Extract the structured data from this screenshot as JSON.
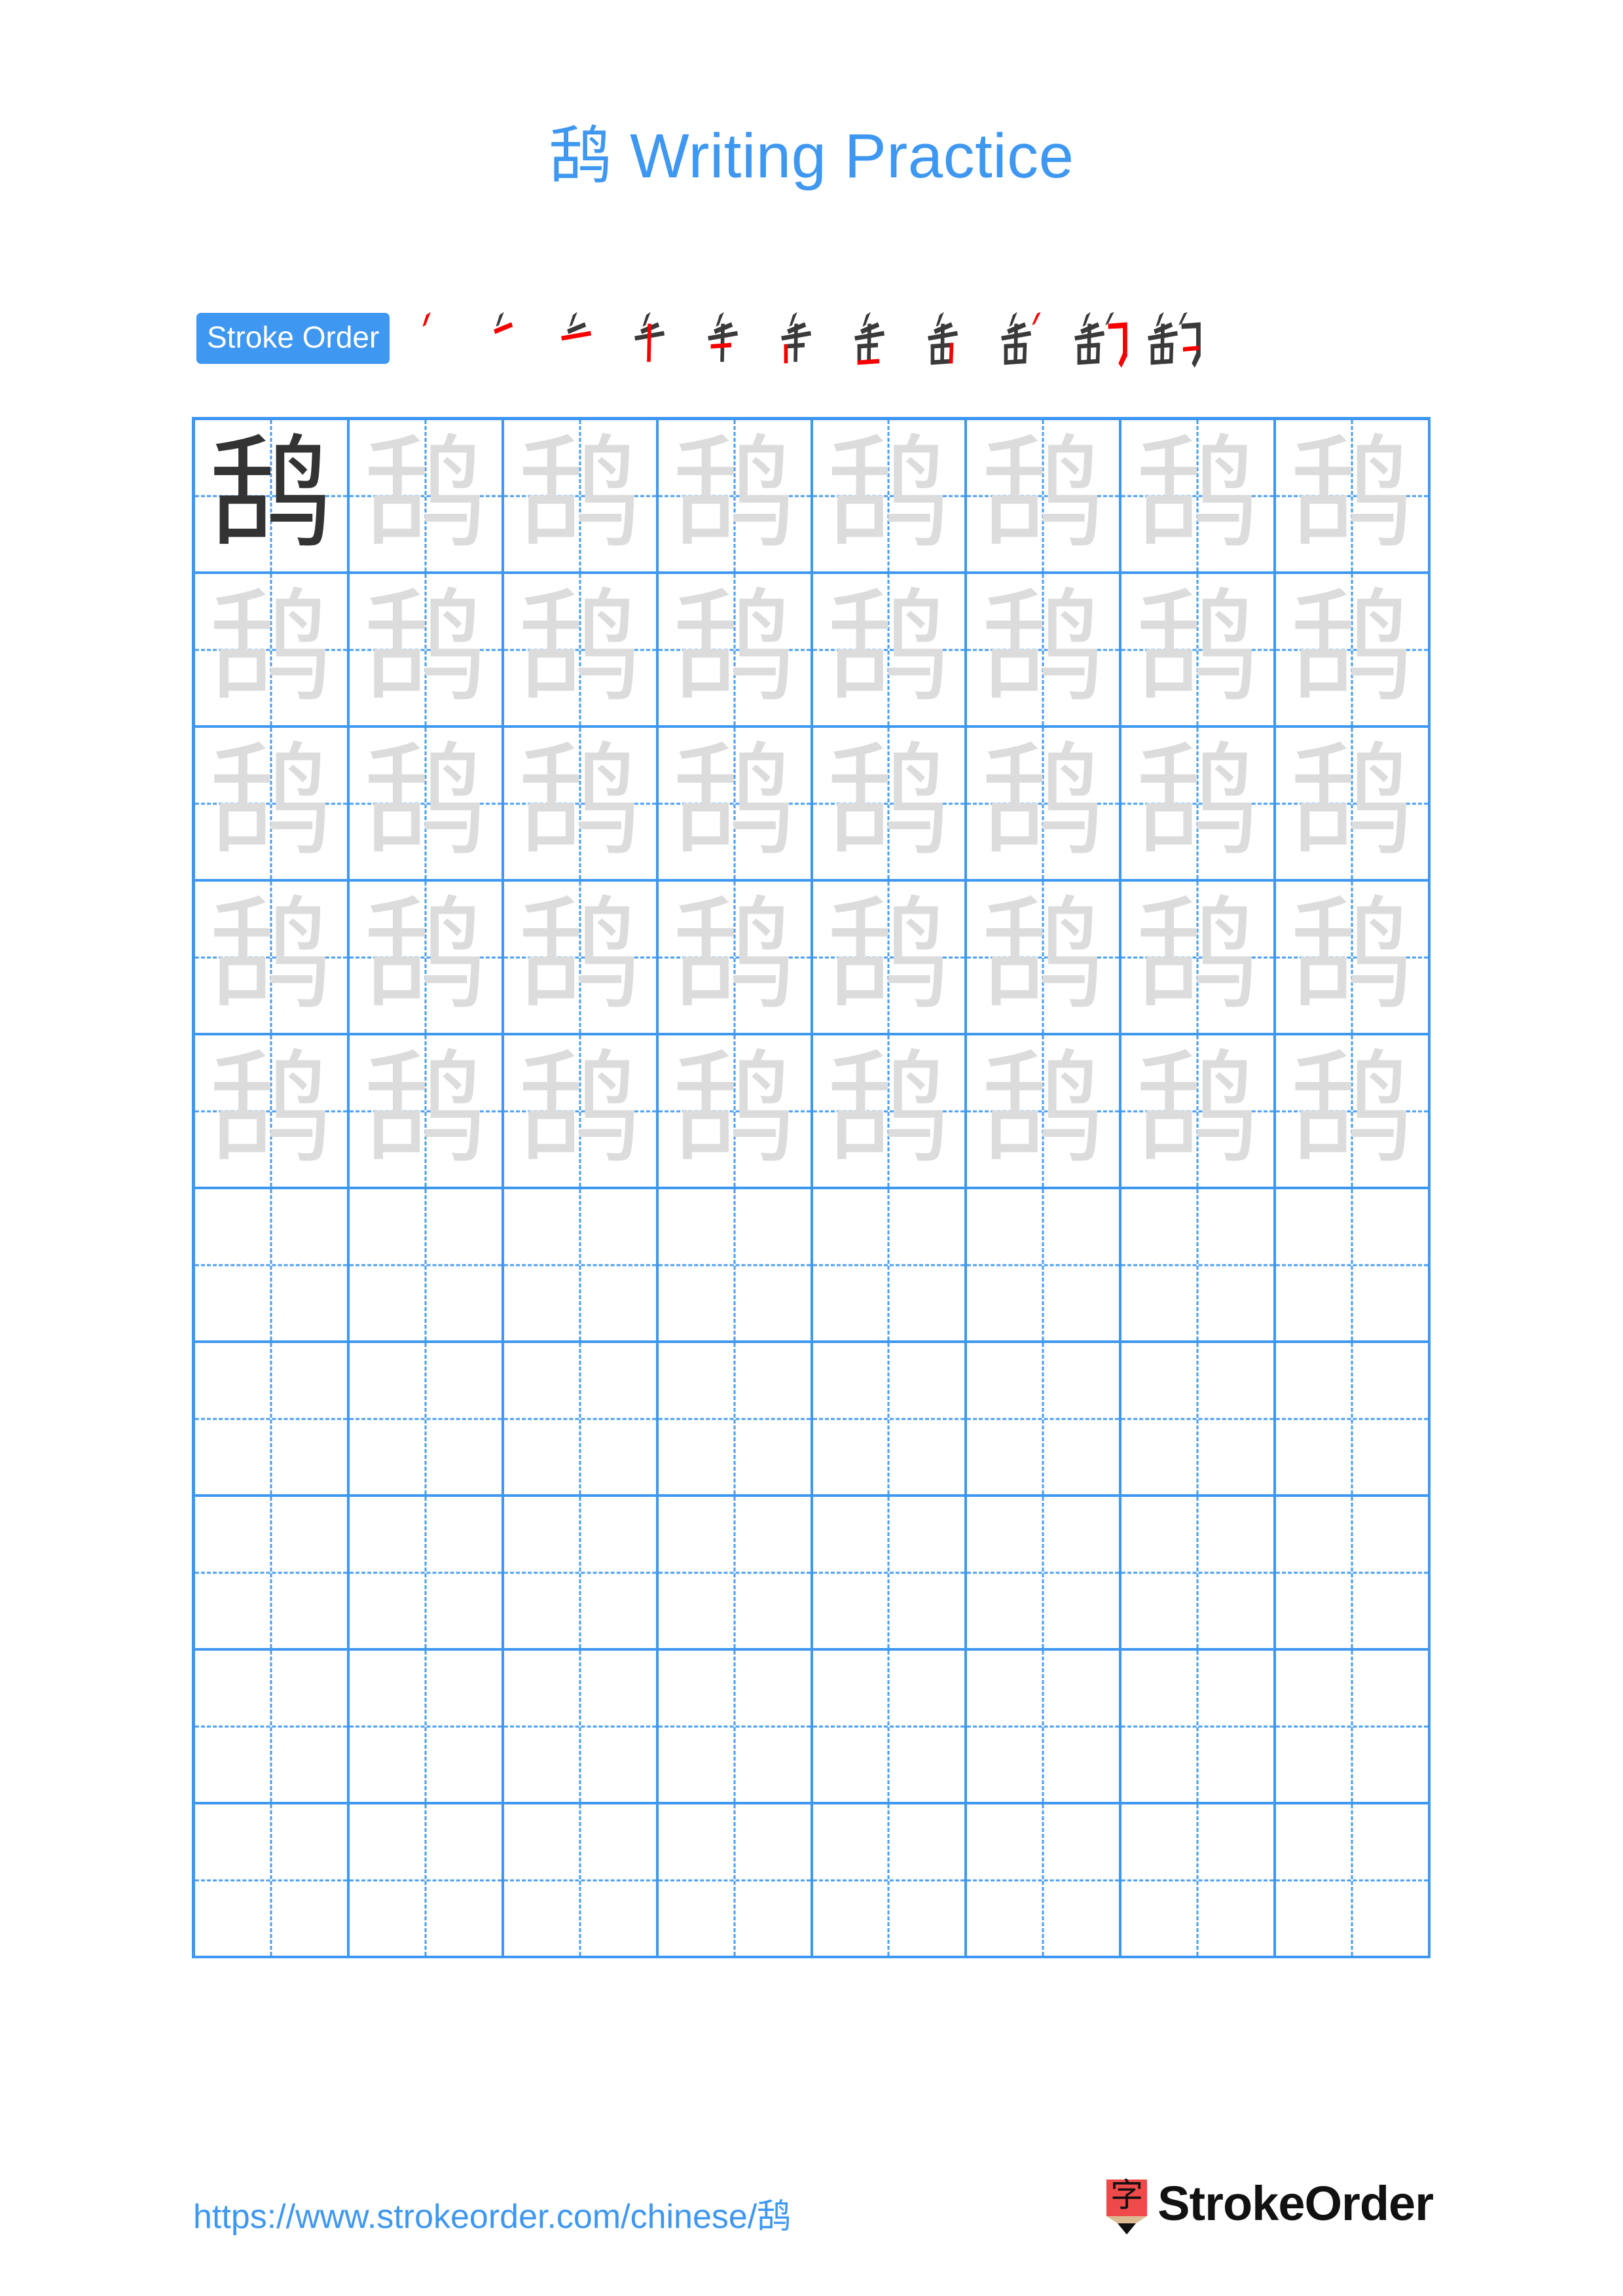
{
  "page": {
    "character": "鸹",
    "background_color": "#ffffff",
    "accent_color": "#3e97f0",
    "grid_line_color": "#4a9ef2",
    "trace_color": "#dcdcdc",
    "dark_glyph_color": "#333333",
    "stroke_new_color": "#f60000",
    "stroke_prev_color": "#3a3a3a"
  },
  "title": {
    "text": "鸹 Writing Practice"
  },
  "stroke_order": {
    "badge_label": "Stroke Order",
    "total_strokes": 11,
    "steps": [
      {
        "index": 1,
        "glyph": "丿"
      },
      {
        "index": 2,
        "glyph": "二"
      },
      {
        "index": 3,
        "glyph": "千"
      },
      {
        "index": 4,
        "glyph": "千"
      },
      {
        "index": 5,
        "glyph": "舌"
      },
      {
        "index": 6,
        "glyph": "舌"
      },
      {
        "index": 7,
        "glyph": "舌"
      },
      {
        "index": 8,
        "glyph": "舌"
      },
      {
        "index": 9,
        "glyph": "舌"
      },
      {
        "index": 10,
        "glyph": "鸹"
      },
      {
        "index": 11,
        "glyph": "鸹"
      }
    ]
  },
  "grid": {
    "columns": 8,
    "rows": 10,
    "filled_rows": 5,
    "empty_rows": 5,
    "cells": [
      [
        "dark",
        "trace",
        "trace",
        "trace",
        "trace",
        "trace",
        "trace",
        "trace"
      ],
      [
        "trace",
        "trace",
        "trace",
        "trace",
        "trace",
        "trace",
        "trace",
        "trace"
      ],
      [
        "trace",
        "trace",
        "trace",
        "trace",
        "trace",
        "trace",
        "trace",
        "trace"
      ],
      [
        "trace",
        "trace",
        "trace",
        "trace",
        "trace",
        "trace",
        "trace",
        "trace"
      ],
      [
        "trace",
        "trace",
        "trace",
        "trace",
        "trace",
        "trace",
        "trace",
        "trace"
      ],
      [
        "empty",
        "empty",
        "empty",
        "empty",
        "empty",
        "empty",
        "empty",
        "empty"
      ],
      [
        "empty",
        "empty",
        "empty",
        "empty",
        "empty",
        "empty",
        "empty",
        "empty"
      ],
      [
        "empty",
        "empty",
        "empty",
        "empty",
        "empty",
        "empty",
        "empty",
        "empty"
      ],
      [
        "empty",
        "empty",
        "empty",
        "empty",
        "empty",
        "empty",
        "empty",
        "empty"
      ],
      [
        "empty",
        "empty",
        "empty",
        "empty",
        "empty",
        "empty",
        "empty",
        "empty"
      ]
    ]
  },
  "footer": {
    "url": "https://www.strokeorder.com/chinese/鸹",
    "brand_name": "StrokeOrder",
    "brand_mark_character": "字",
    "brand_mark_body_color": "#ef4a4a",
    "brand_mark_wood_color": "#ddbb92",
    "brand_mark_tip_color": "#101010"
  }
}
